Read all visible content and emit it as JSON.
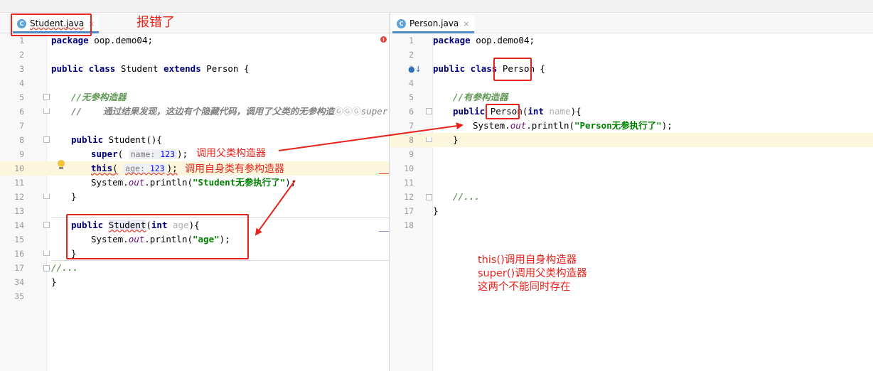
{
  "left_tab": {
    "label": "Student.java",
    "icon": "class-c-icon",
    "close": "×"
  },
  "right_tab": {
    "label": "Person.java",
    "icon": "class-c-icon",
    "close": "×"
  },
  "annotations": {
    "error_note": "报错了",
    "call_super": "调用父类构造器",
    "call_self": "调用自身类有参构造器",
    "summary_line1": "this()调用自身构造器",
    "summary_line2": "super()调用父类构造器",
    "summary_line3": "这两个不能同时存在"
  },
  "left_code": {
    "line_numbers": [
      "1",
      "2",
      "3",
      "4",
      "5",
      "6",
      "7",
      "8",
      "9",
      "10",
      "11",
      "12",
      "13",
      "14",
      "15",
      "16",
      "17",
      "34",
      "35"
    ],
    "l1_kw": "package",
    "l1_rest": " oop.demo04;",
    "l3_kw1": "public class",
    "l3_name": " Student ",
    "l3_kw2": "extends",
    "l3_rest": " Person {",
    "l5_comment": "//无参构造器",
    "l6_comment_a": "//    通过结果发现，这边有个隐藏代码，调用了父类的无参构造",
    "l6_comment_b": "super",
    "l8_kw": "public",
    "l8_rest": " Student(){",
    "l9_kw": "super",
    "l9_open": "(",
    "l9_hint_name": "name:",
    "l9_hint_val": "123",
    "l9_close": ");",
    "l10_kw": "this",
    "l10_open": "(",
    "l10_hint_name": "age:",
    "l10_hint_val": "123",
    "l10_close": ");",
    "l11_pre": "System.",
    "l11_out": "out",
    "l11_mid": ".println(",
    "l11_str": "\"Student无参执行了\"",
    "l11_end": ");",
    "l12": "}",
    "l14_kw": "public",
    "l14_name": "Student",
    "l14_paren": "(",
    "l14_kwint": "int",
    "l14_param": " age",
    "l14_end": "){",
    "l15_pre": "System.",
    "l15_out": "out",
    "l15_mid": ".println(",
    "l15_str": "\"age\"",
    "l15_end": ");",
    "l16": "}",
    "l17": "//...",
    "l34": "}"
  },
  "right_code": {
    "line_numbers": [
      "1",
      "2",
      "3",
      "4",
      "5",
      "6",
      "7",
      "8",
      "9",
      "10",
      "11",
      "12",
      "17",
      "18"
    ],
    "l1_kw": "package",
    "l1_rest": " oop.demo04;",
    "l3_kw": "public class",
    "l3_name": "Person",
    "l3_rest": " {",
    "l5_comment": "//有参构造器",
    "l6_kw": "public",
    "l6_name": "Person",
    "l6_paren": "(",
    "l6_kwint": "int",
    "l6_param": " name",
    "l6_end": "){",
    "l7_pre": "System.",
    "l7_out": "out",
    "l7_mid": ".println(",
    "l7_str": "\"Person无参执行了\"",
    "l7_end": ");",
    "l8": "}",
    "l12": "//...",
    "l17": "}"
  },
  "colors": {
    "annotation_red": "#e8231b",
    "keyword": "#000080",
    "string": "#008000",
    "current_line": "#fbf6dc"
  }
}
